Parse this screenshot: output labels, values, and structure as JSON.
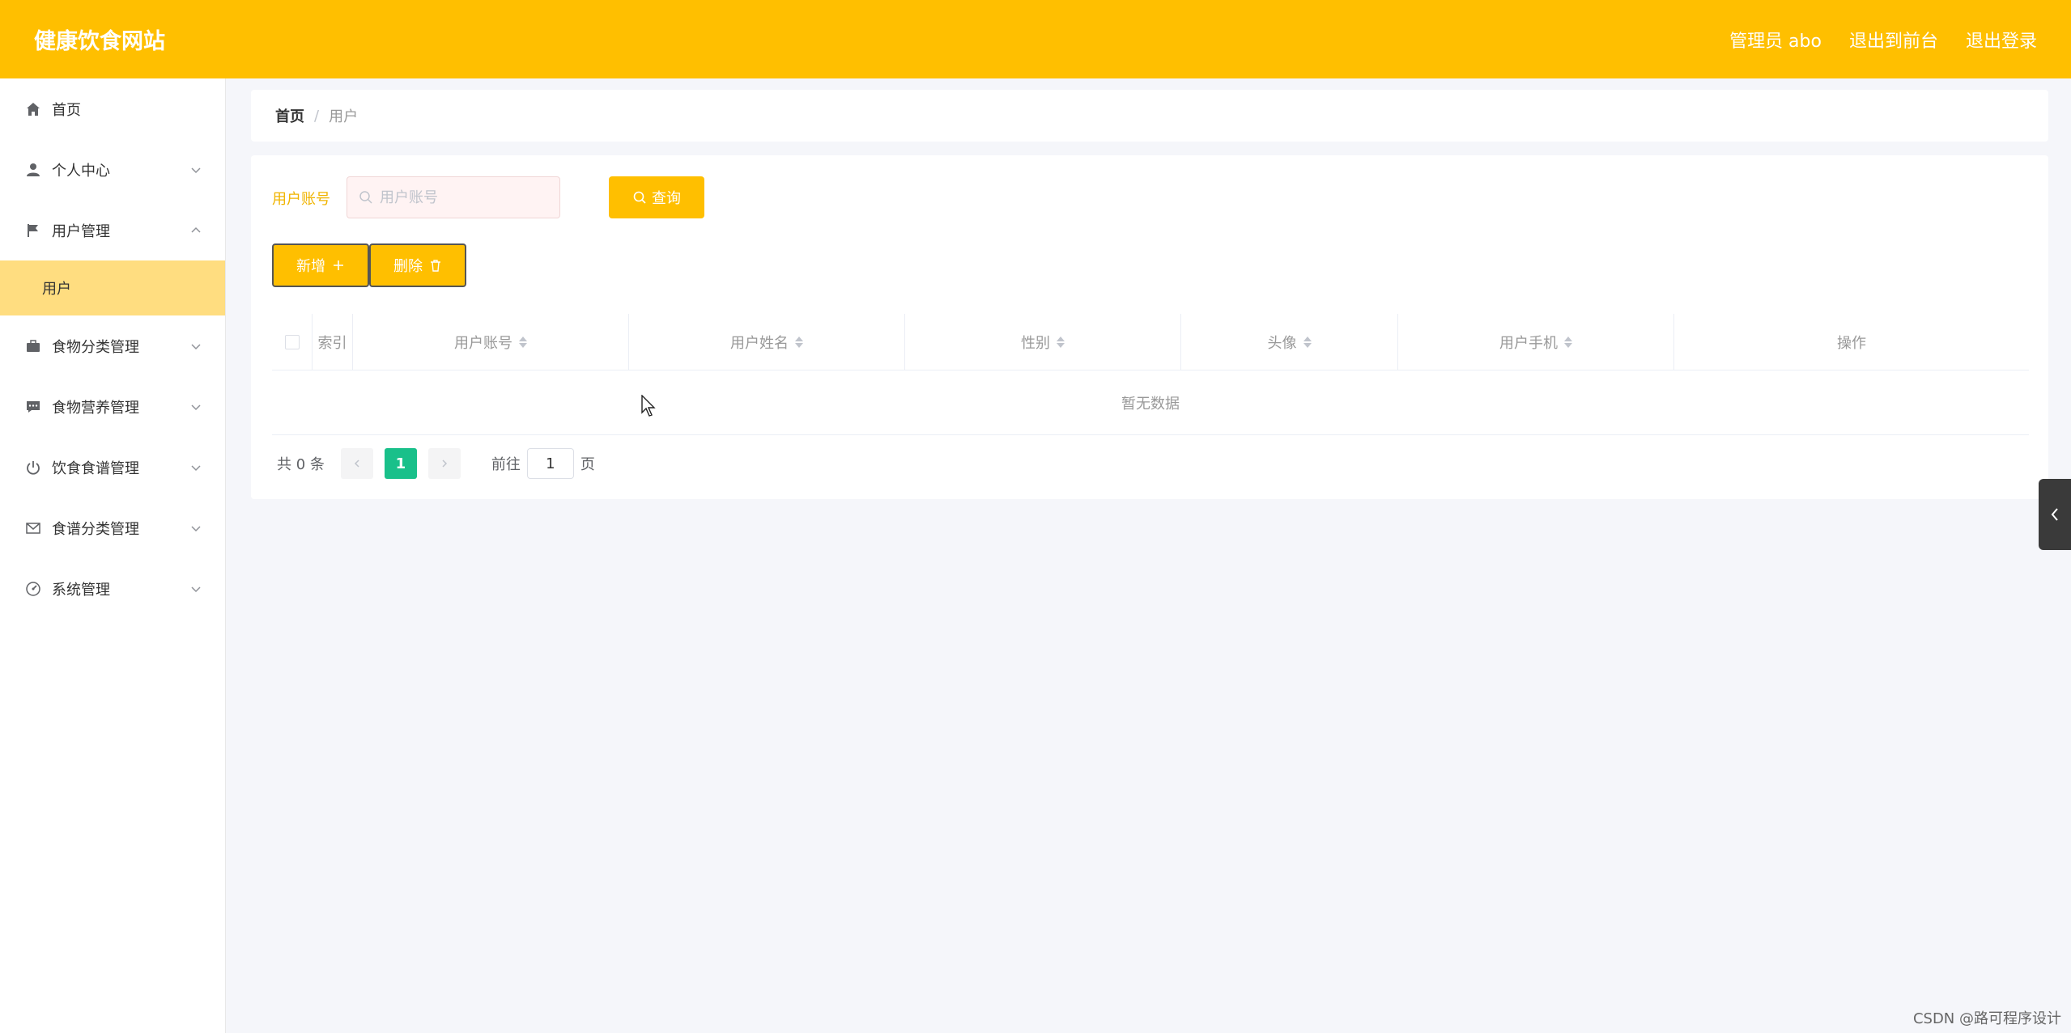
{
  "header": {
    "title": "健康饮食网站",
    "admin_label": "管理员 abo",
    "to_front_label": "退出到前台",
    "logout_label": "退出登录"
  },
  "sidebar": {
    "items": [
      {
        "label": "首页",
        "icon": "home-icon"
      },
      {
        "label": "个人中心",
        "icon": "user-icon"
      },
      {
        "label": "用户管理",
        "icon": "flag-icon",
        "expanded": true,
        "children": [
          {
            "label": "用户",
            "active": true
          }
        ]
      },
      {
        "label": "食物分类管理",
        "icon": "briefcase-icon"
      },
      {
        "label": "食物营养管理",
        "icon": "message-icon"
      },
      {
        "label": "饮食食谱管理",
        "icon": "power-icon"
      },
      {
        "label": "食谱分类管理",
        "icon": "mail-icon"
      },
      {
        "label": "系统管理",
        "icon": "gauge-icon"
      }
    ]
  },
  "breadcrumb": {
    "home": "首页",
    "separator": "/",
    "current": "用户"
  },
  "search": {
    "label": "用户账号",
    "placeholder": "用户账号",
    "query_label": "查询"
  },
  "actions": {
    "add_label": "新增",
    "delete_label": "删除"
  },
  "table": {
    "columns": [
      "索引",
      "用户账号",
      "用户姓名",
      "性别",
      "头像",
      "用户手机",
      "操作"
    ],
    "empty_text": "暂无数据"
  },
  "pagination": {
    "total_text": "共 0 条",
    "current_page": "1",
    "goto_label": "前往",
    "goto_value": "1",
    "page_unit": "页"
  },
  "watermark": "CSDN @路可程序设计",
  "colors": {
    "primary": "#ffbf00",
    "active_submenu": "#ffdd80",
    "page_active": "#19c08a"
  }
}
